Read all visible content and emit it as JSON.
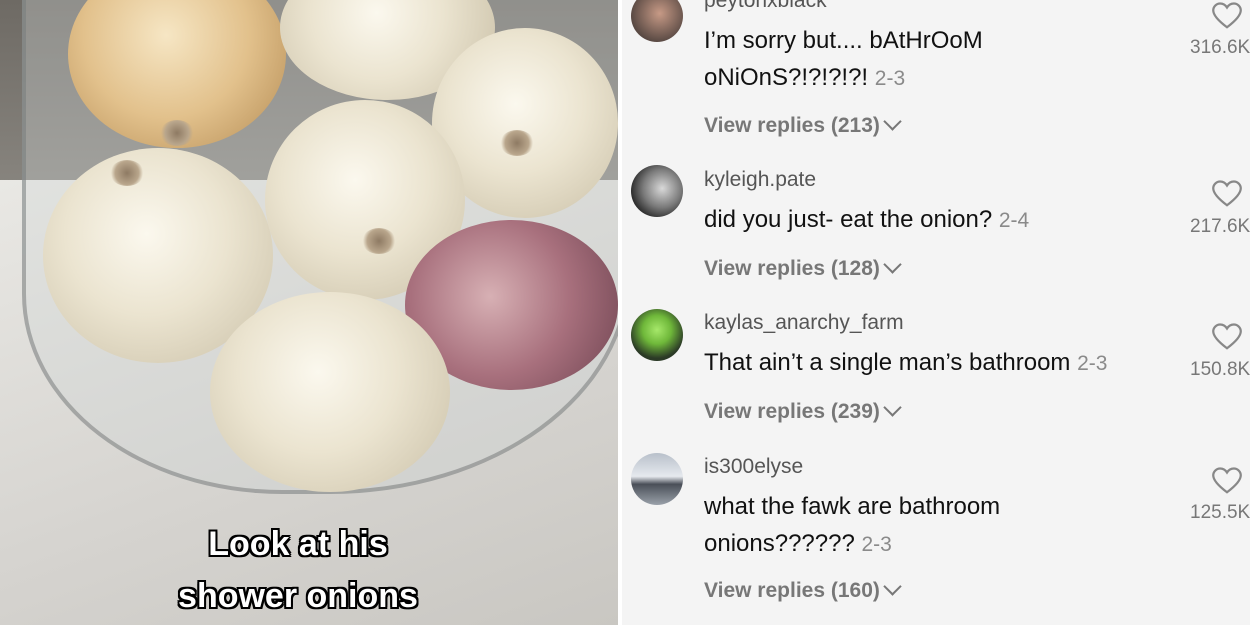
{
  "video": {
    "caption_line1": "Look at his",
    "caption_line2": "shower onions"
  },
  "comments": [
    {
      "username": "peytonxblack",
      "text_line1": "I’m sorry but.... bAtHrOoM",
      "text_line2": "oNiOnS?!?!?!?!",
      "date": "2-3",
      "replies": "View replies (213)",
      "likes": "316.6K",
      "avatar_colors": [
        "#5a4a44",
        "#c79a86"
      ]
    },
    {
      "username": "kyleigh.pate",
      "text_line1": "did you just- eat the onion?",
      "text_line2": "",
      "date": "2-4",
      "replies": "View replies (128)",
      "likes": "217.6K",
      "avatar_colors": [
        "#2a2a2a",
        "#bdbdbd"
      ]
    },
    {
      "username": "kaylas_anarchy_farm",
      "text_line1": "That ain’t a single man’s bathroom",
      "text_line2": "",
      "date": "2-3",
      "replies": "View replies (239)",
      "likes": "150.8K",
      "avatar_colors": [
        "#1f2b1c",
        "#8fd44a"
      ]
    },
    {
      "username": "is300elyse",
      "text_line1": "what the fawk are bathroom",
      "text_line2": "onions??????",
      "date": "2-3",
      "replies": "View replies (160)",
      "likes": "125.5K",
      "avatar_colors": [
        "#6d7480",
        "#d8dde3"
      ]
    }
  ]
}
